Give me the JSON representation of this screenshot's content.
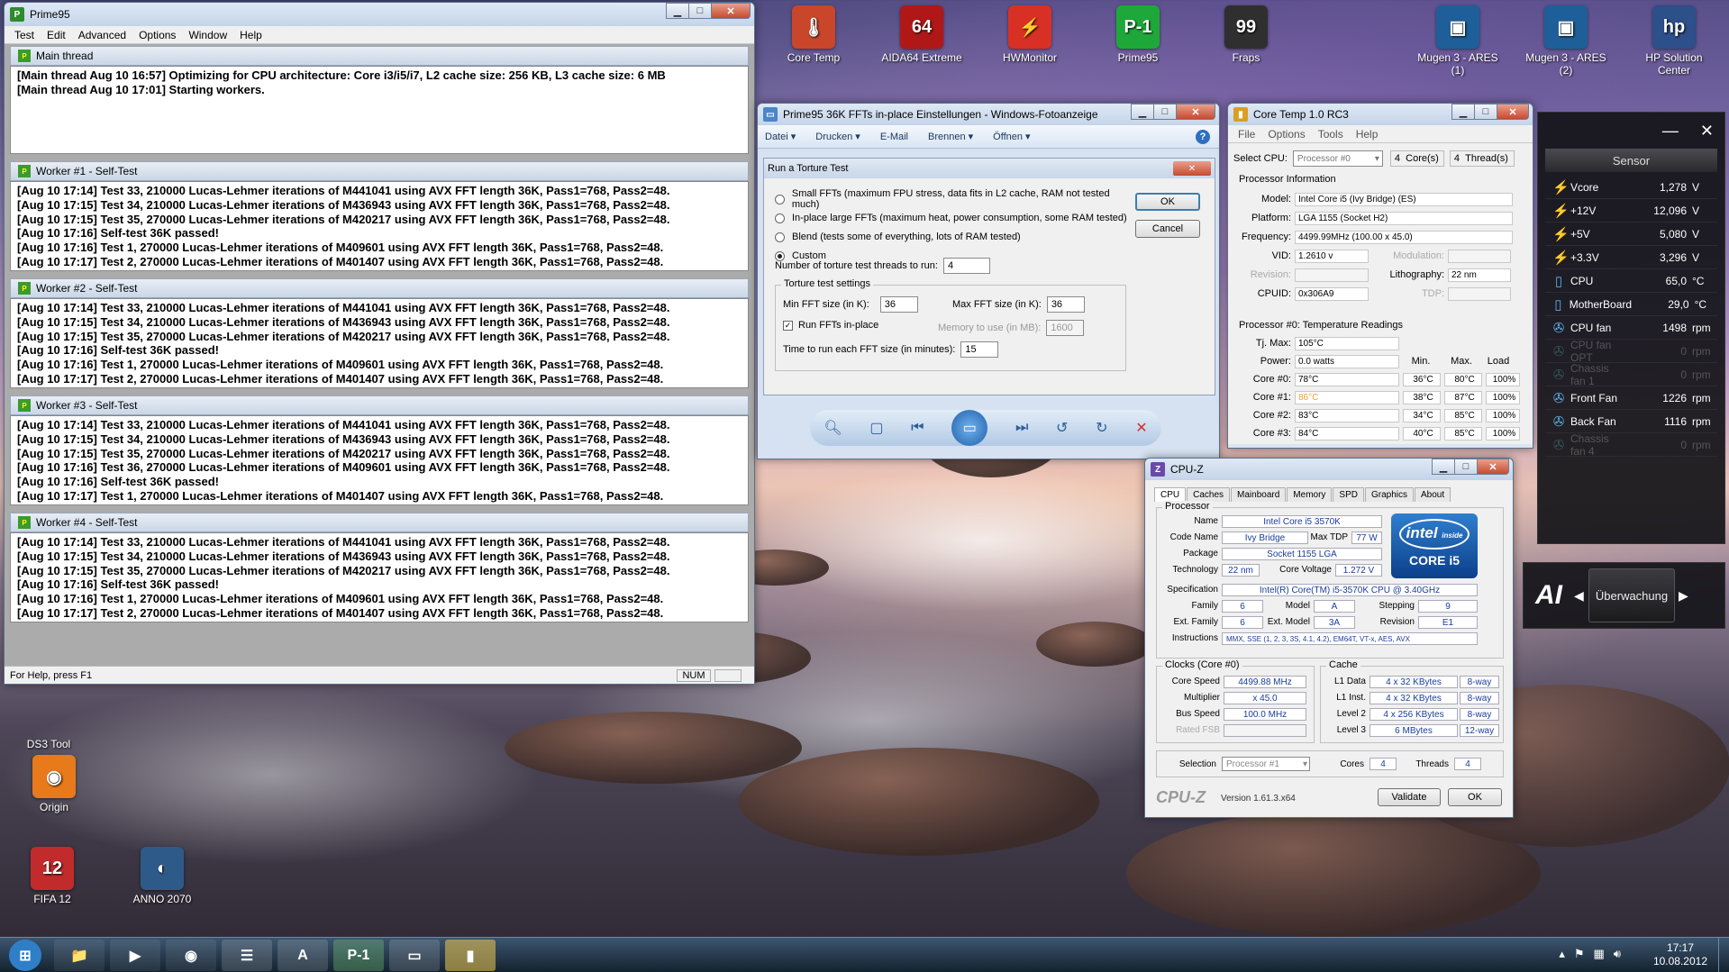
{
  "desktop": {
    "icons": [
      {
        "label": "Core Temp",
        "icon": "core-temp-icon",
        "glyph": "🌡"
      },
      {
        "label": "AIDA64 Extreme",
        "icon": "aida64-icon",
        "glyph": "64"
      },
      {
        "label": "HWMonitor",
        "icon": "hwmonitor-icon",
        "glyph": "⚡"
      },
      {
        "label": "Prime95",
        "icon": "prime95-icon",
        "glyph": "P-1"
      },
      {
        "label": "Fraps",
        "icon": "fraps-icon",
        "glyph": "99"
      },
      {
        "label": "Mugen 3 - ARES (1)",
        "icon": "mugen-icon",
        "glyph": "▣"
      },
      {
        "label": "Mugen 3 - ARES (2)",
        "icon": "mugen-icon",
        "glyph": "▣"
      },
      {
        "label": "HP Solution Center",
        "icon": "hp-icon",
        "glyph": "hp"
      },
      {
        "label": "DS3 Tool",
        "icon": "ds3-tool-icon",
        "glyph": ""
      },
      {
        "label": "Origin",
        "icon": "origin-icon",
        "glyph": "◉"
      },
      {
        "label": "FIFA 12",
        "icon": "fifa-icon",
        "glyph": "12"
      },
      {
        "label": "ANNO 2070",
        "icon": "anno-icon",
        "glyph": "◐"
      }
    ]
  },
  "prime95": {
    "title": "Prime95",
    "menu": [
      "Test",
      "Edit",
      "Advanced",
      "Options",
      "Window",
      "Help"
    ],
    "main_title": "Main thread",
    "main_lines": [
      "[Main thread Aug 10 16:57] Optimizing for CPU architecture: Core i3/i5/i7, L2 cache size: 256 KB, L3 cache size: 6 MB",
      "[Main thread Aug 10 17:01] Starting workers."
    ],
    "workers": [
      {
        "title": "Worker #1 - Self-Test",
        "lines": [
          "[Aug 10 17:14] Test 33, 210000 Lucas-Lehmer iterations of M441041 using AVX FFT length 36K, Pass1=768, Pass2=48.",
          "[Aug 10 17:15] Test 34, 210000 Lucas-Lehmer iterations of M436943 using AVX FFT length 36K, Pass1=768, Pass2=48.",
          "[Aug 10 17:15] Test 35, 270000 Lucas-Lehmer iterations of M420217 using AVX FFT length 36K, Pass1=768, Pass2=48.",
          "[Aug 10 17:16] Self-test 36K passed!",
          "[Aug 10 17:16] Test 1, 270000 Lucas-Lehmer iterations of M409601 using AVX FFT length 36K, Pass1=768, Pass2=48.",
          "[Aug 10 17:17] Test 2, 270000 Lucas-Lehmer iterations of M401407 using AVX FFT length 36K, Pass1=768, Pass2=48."
        ]
      },
      {
        "title": "Worker #2 - Self-Test",
        "lines": [
          "[Aug 10 17:14] Test 33, 210000 Lucas-Lehmer iterations of M441041 using AVX FFT length 36K, Pass1=768, Pass2=48.",
          "[Aug 10 17:15] Test 34, 210000 Lucas-Lehmer iterations of M436943 using AVX FFT length 36K, Pass1=768, Pass2=48.",
          "[Aug 10 17:15] Test 35, 270000 Lucas-Lehmer iterations of M420217 using AVX FFT length 36K, Pass1=768, Pass2=48.",
          "[Aug 10 17:16] Self-test 36K passed!",
          "[Aug 10 17:16] Test 1, 270000 Lucas-Lehmer iterations of M409601 using AVX FFT length 36K, Pass1=768, Pass2=48.",
          "[Aug 10 17:17] Test 2, 270000 Lucas-Lehmer iterations of M401407 using AVX FFT length 36K, Pass1=768, Pass2=48."
        ]
      },
      {
        "title": "Worker #3 - Self-Test",
        "lines": [
          "[Aug 10 17:14] Test 33, 210000 Lucas-Lehmer iterations of M441041 using AVX FFT length 36K, Pass1=768, Pass2=48.",
          "[Aug 10 17:15] Test 34, 210000 Lucas-Lehmer iterations of M436943 using AVX FFT length 36K, Pass1=768, Pass2=48.",
          "[Aug 10 17:15] Test 35, 270000 Lucas-Lehmer iterations of M420217 using AVX FFT length 36K, Pass1=768, Pass2=48.",
          "[Aug 10 17:16] Test 36, 270000 Lucas-Lehmer iterations of M409601 using AVX FFT length 36K, Pass1=768, Pass2=48.",
          "[Aug 10 17:16] Self-test 36K passed!",
          "[Aug 10 17:17] Test 1, 270000 Lucas-Lehmer iterations of M401407 using AVX FFT length 36K, Pass1=768, Pass2=48."
        ]
      },
      {
        "title": "Worker #4 - Self-Test",
        "lines": [
          "[Aug 10 17:14] Test 33, 210000 Lucas-Lehmer iterations of M441041 using AVX FFT length 36K, Pass1=768, Pass2=48.",
          "[Aug 10 17:15] Test 34, 210000 Lucas-Lehmer iterations of M436943 using AVX FFT length 36K, Pass1=768, Pass2=48.",
          "[Aug 10 17:15] Test 35, 270000 Lucas-Lehmer iterations of M420217 using AVX FFT length 36K, Pass1=768, Pass2=48.",
          "[Aug 10 17:16] Self-test 36K passed!",
          "[Aug 10 17:16] Test 1, 270000 Lucas-Lehmer iterations of M409601 using AVX FFT length 36K, Pass1=768, Pass2=48.",
          "[Aug 10 17:17] Test 2, 270000 Lucas-Lehmer iterations of M401407 using AVX FFT length 36K, Pass1=768, Pass2=48."
        ]
      }
    ],
    "status_text": "For Help, press F1",
    "status_num": "NUM"
  },
  "photo_viewer": {
    "title": "Prime95 36K FFTs in-place Einstellungen - Windows-Fotoanzeige",
    "menu": [
      "Datei",
      "Drucken",
      "E-Mail",
      "Brennen",
      "Öffnen"
    ],
    "help": "?"
  },
  "torture": {
    "title": "Run a Torture Test",
    "options": [
      {
        "label": "Small FFTs (maximum FPU stress, data fits in L2 cache, RAM not tested much)",
        "checked": false
      },
      {
        "label": "In-place large FFTs (maximum heat, power consumption, some RAM tested)",
        "checked": false
      },
      {
        "label": "Blend (tests some of everything, lots of RAM tested)",
        "checked": false
      },
      {
        "label": "Custom",
        "checked": true
      }
    ],
    "threads_label": "Number of torture test threads to run:",
    "threads_value": "4",
    "settings_label": "Torture test settings",
    "min_fft_label": "Min FFT size (in K):",
    "min_fft_value": "36",
    "max_fft_label": "Max FFT size (in K):",
    "max_fft_value": "36",
    "inplace_label": "Run FFTs in-place",
    "memory_label": "Memory to use (in MB):",
    "memory_value": "1600",
    "time_label": "Time to run each FFT size (in minutes):",
    "time_value": "15",
    "ok": "OK",
    "cancel": "Cancel"
  },
  "coretemp": {
    "title": "Core Temp 1.0 RC3",
    "menu": [
      "File",
      "Options",
      "Tools",
      "Help"
    ],
    "select_cpu_label": "Select CPU:",
    "select_cpu_value": "Processor #0",
    "cores_value": "4",
    "cores_label": "Core(s)",
    "threads_value": "4",
    "threads_label": "Thread(s)",
    "info_header": "Processor Information",
    "model_label": "Model:",
    "model_value": "Intel Core i5 (Ivy Bridge)  (ES)",
    "platform_label": "Platform:",
    "platform_value": "LGA 1155 (Socket H2)",
    "freq_label": "Frequency:",
    "freq_value": "4499.99MHz (100.00 x 45.0)",
    "vid_label": "VID:",
    "vid_value": "1.2610 v",
    "modulation_label": "Modulation:",
    "revision_label": "Revision:",
    "litho_label": "Lithography:",
    "litho_value": "22 nm",
    "cpuid_label": "CPUID:",
    "cpuid_value": "0x306A9",
    "tdp_label": "TDP:",
    "temp_header": "Processor #0: Temperature Readings",
    "tjmax_label": "Tj. Max:",
    "tjmax_value": "105°C",
    "power_label": "Power:",
    "power_value": "0.0 watts",
    "col_min": "Min.",
    "col_max": "Max.",
    "col_load": "Load",
    "cores": [
      {
        "label": "Core #0:",
        "temp": "78°C",
        "min": "36°C",
        "max": "80°C",
        "load": "100%"
      },
      {
        "label": "Core #1:",
        "temp": "86°C",
        "min": "38°C",
        "max": "87°C",
        "load": "100%"
      },
      {
        "label": "Core #2:",
        "temp": "83°C",
        "min": "34°C",
        "max": "85°C",
        "load": "100%"
      },
      {
        "label": "Core #3:",
        "temp": "84°C",
        "min": "40°C",
        "max": "85°C",
        "load": "100%"
      }
    ]
  },
  "sensor": {
    "header": "Sensor",
    "rows": [
      {
        "name": "Vcore",
        "value": "1,278",
        "unit": "V",
        "icon": "bolt-icon",
        "active": true
      },
      {
        "name": "+12V",
        "value": "12,096",
        "unit": "V",
        "icon": "bolt-icon",
        "active": true
      },
      {
        "name": "+5V",
        "value": "5,080",
        "unit": "V",
        "icon": "bolt-icon",
        "active": true
      },
      {
        "name": "+3.3V",
        "value": "3,296",
        "unit": "V",
        "icon": "bolt-icon",
        "active": true
      },
      {
        "name": "CPU",
        "value": "65,0",
        "unit": "°C",
        "icon": "thermometer-icon",
        "active": true
      },
      {
        "name": "MotherBoard",
        "value": "29,0",
        "unit": "°C",
        "icon": "thermometer-icon",
        "active": true
      },
      {
        "name": "CPU fan",
        "value": "1498",
        "unit": "rpm",
        "icon": "fan-icon",
        "active": true
      },
      {
        "name": "CPU fan OPT",
        "value": "0",
        "unit": "rpm",
        "icon": "fan-icon",
        "active": false
      },
      {
        "name": "Chassis fan 1",
        "value": "0",
        "unit": "rpm",
        "icon": "fan-icon",
        "active": false
      },
      {
        "name": "Front Fan",
        "value": "1226",
        "unit": "rpm",
        "icon": "fan-icon",
        "active": true
      },
      {
        "name": "Back Fan",
        "value": "1116",
        "unit": "rpm",
        "icon": "fan-icon",
        "active": true
      },
      {
        "name": "Chassis fan 4",
        "value": "0",
        "unit": "rpm",
        "icon": "fan-icon",
        "active": false
      }
    ],
    "nav_label": "Überwachung"
  },
  "cpuz": {
    "title": "CPU-Z",
    "tabs": [
      "CPU",
      "Caches",
      "Mainboard",
      "Memory",
      "SPD",
      "Graphics",
      "About"
    ],
    "processor_label": "Processor",
    "name_label": "Name",
    "name_value": "Intel Core i5 3570K",
    "codename_label": "Code Name",
    "codename_value": "Ivy Bridge",
    "maxtdp_label": "Max TDP",
    "maxtdp_value": "77 W",
    "package_label": "Package",
    "package_value": "Socket 1155 LGA",
    "tech_label": "Technology",
    "tech_value": "22 nm",
    "corevolt_label": "Core Voltage",
    "corevolt_value": "1.272 V",
    "spec_label": "Specification",
    "spec_value": "Intel(R) Core(TM) i5-3570K CPU @ 3.40GHz",
    "family_label": "Family",
    "family_value": "6",
    "model_label": "Model",
    "model_value": "A",
    "stepping_label": "Stepping",
    "stepping_value": "9",
    "extfamily_label": "Ext. Family",
    "extfamily_value": "6",
    "extmodel_label": "Ext. Model",
    "extmodel_value": "3A",
    "revision_label": "Revision",
    "revision_value": "E1",
    "instr_label": "Instructions",
    "instr_value": "MMX, SSE (1, 2, 3, 3S, 4.1, 4.2), EM64T, VT-x, AES, AVX",
    "clocks_label": "Clocks (Core #0)",
    "corespeed_label": "Core Speed",
    "corespeed_value": "4499.88 MHz",
    "multiplier_label": "Multiplier",
    "multiplier_value": "x 45.0",
    "busspeed_label": "Bus Speed",
    "busspeed_value": "100.0 MHz",
    "ratedfsb_label": "Rated FSB",
    "cache_label": "Cache",
    "l1d_label": "L1 Data",
    "l1d_value": "4 x 32 KBytes",
    "l1d_way": "8-way",
    "l1i_label": "L1 Inst.",
    "l1i_value": "4 x 32 KBytes",
    "l1i_way": "8-way",
    "l2_label": "Level 2",
    "l2_value": "4 x 256 KBytes",
    "l2_way": "8-way",
    "l3_label": "Level 3",
    "l3_value": "6 MBytes",
    "l3_way": "12-way",
    "selection_label": "Selection",
    "selection_value": "Processor #1",
    "cores_label": "Cores",
    "cores_value": "4",
    "threads_label": "Threads",
    "threads_value": "4",
    "brand": "CPU-Z",
    "version": "Version 1.61.3.x64",
    "validate": "Validate",
    "ok": "OK",
    "intel_inside": "intel",
    "intel_inside_sub": "inside",
    "core_i5": "CORE i5"
  },
  "taskbar": {
    "clock_time": "17:17",
    "clock_date": "10.08.2012",
    "buttons": [
      {
        "icon": "start-orb-icon",
        "glyph": "⊞"
      },
      {
        "icon": "explorer-icon",
        "glyph": "📁"
      },
      {
        "icon": "media-player-icon",
        "glyph": "▶"
      },
      {
        "icon": "firefox-icon",
        "glyph": "◉"
      },
      {
        "icon": "notepad-icon",
        "glyph": "☰"
      },
      {
        "icon": "aida64-icon",
        "glyph": "A"
      },
      {
        "icon": "prime95-icon",
        "glyph": "P-1"
      },
      {
        "icon": "photo-viewer-icon",
        "glyph": "▭"
      },
      {
        "icon": "core-temp-icon",
        "glyph": "▮"
      }
    ]
  }
}
